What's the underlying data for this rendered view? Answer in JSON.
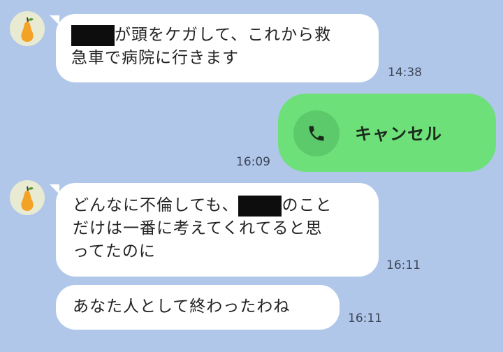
{
  "messages": [
    {
      "text_lines": [
        "が頭をケガして、これから救",
        "急車で病院に行きます"
      ],
      "time": "14:38"
    },
    {
      "call_label": "キャンセル",
      "icon": "phone-icon",
      "time": "16:09"
    },
    {
      "text_lines": [
        "のこと",
        "だけは一番に考えてくれてると思",
        "ってたのに"
      ],
      "time": "16:11"
    },
    {
      "text_lines": [
        "あなた人として終わったわね"
      ],
      "time": "16:11"
    }
  ],
  "colors": {
    "background": "#b0c7ea",
    "incoming_bubble": "#ffffff",
    "outgoing_bubble": "#6ee07a",
    "redaction": "#0d0d0d"
  },
  "avatar_icon": "pear-icon"
}
